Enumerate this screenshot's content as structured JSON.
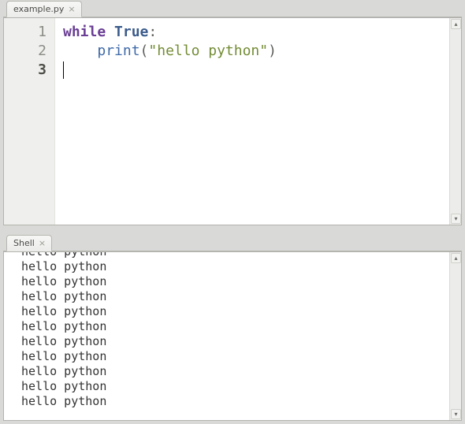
{
  "editor": {
    "tab_label": "example.py",
    "gutter": [
      {
        "n": "1",
        "current": false
      },
      {
        "n": "2",
        "current": false
      },
      {
        "n": "3",
        "current": true
      }
    ],
    "code_lines": [
      {
        "tokens": [
          {
            "cls": "kw",
            "t": "while"
          },
          {
            "cls": "pun",
            "t": " "
          },
          {
            "cls": "bi",
            "t": "True"
          },
          {
            "cls": "pun",
            "t": ":"
          }
        ]
      },
      {
        "tokens": [
          {
            "cls": "pun",
            "t": "    "
          },
          {
            "cls": "fn",
            "t": "print"
          },
          {
            "cls": "pun",
            "t": "("
          },
          {
            "cls": "str",
            "t": "\"hello python\""
          },
          {
            "cls": "pun",
            "t": ")"
          }
        ]
      },
      {
        "tokens": []
      }
    ]
  },
  "shell": {
    "tab_label": "Shell",
    "output_lines": [
      "hello python",
      "hello python",
      "hello python",
      "hello python",
      "hello python",
      "hello python",
      "hello python",
      "hello python",
      "hello python",
      "hello python",
      "hello python"
    ]
  }
}
